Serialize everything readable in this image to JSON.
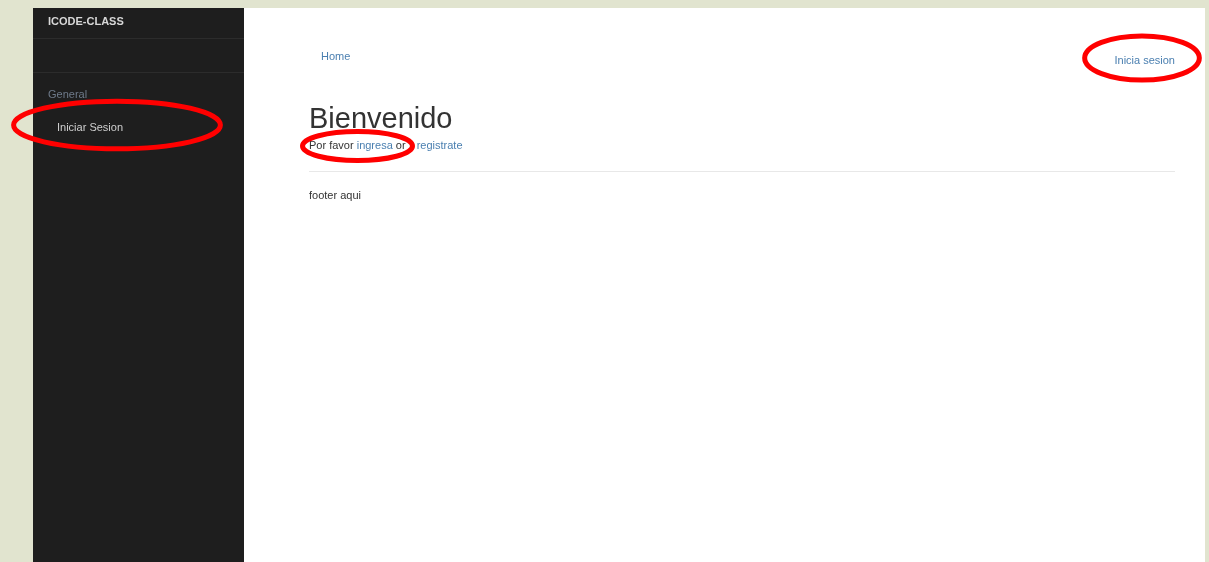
{
  "sidebar": {
    "brand": "ICODE-CLASS",
    "section": "General",
    "items": [
      {
        "label": "Iniciar Sesion",
        "circled": true
      }
    ]
  },
  "nav": {
    "home": "Home",
    "login": {
      "label": "Inicia sesion",
      "circled": true
    }
  },
  "content": {
    "heading": "Bienvenido",
    "intro": [
      {
        "kind": "text",
        "text": "Por favor "
      },
      {
        "kind": "link",
        "text": "ingresa",
        "circled": true
      },
      {
        "kind": "text",
        "text": " or "
      },
      {
        "kind": "link",
        "text": "registrate"
      }
    ],
    "footer": "footer aqui"
  }
}
